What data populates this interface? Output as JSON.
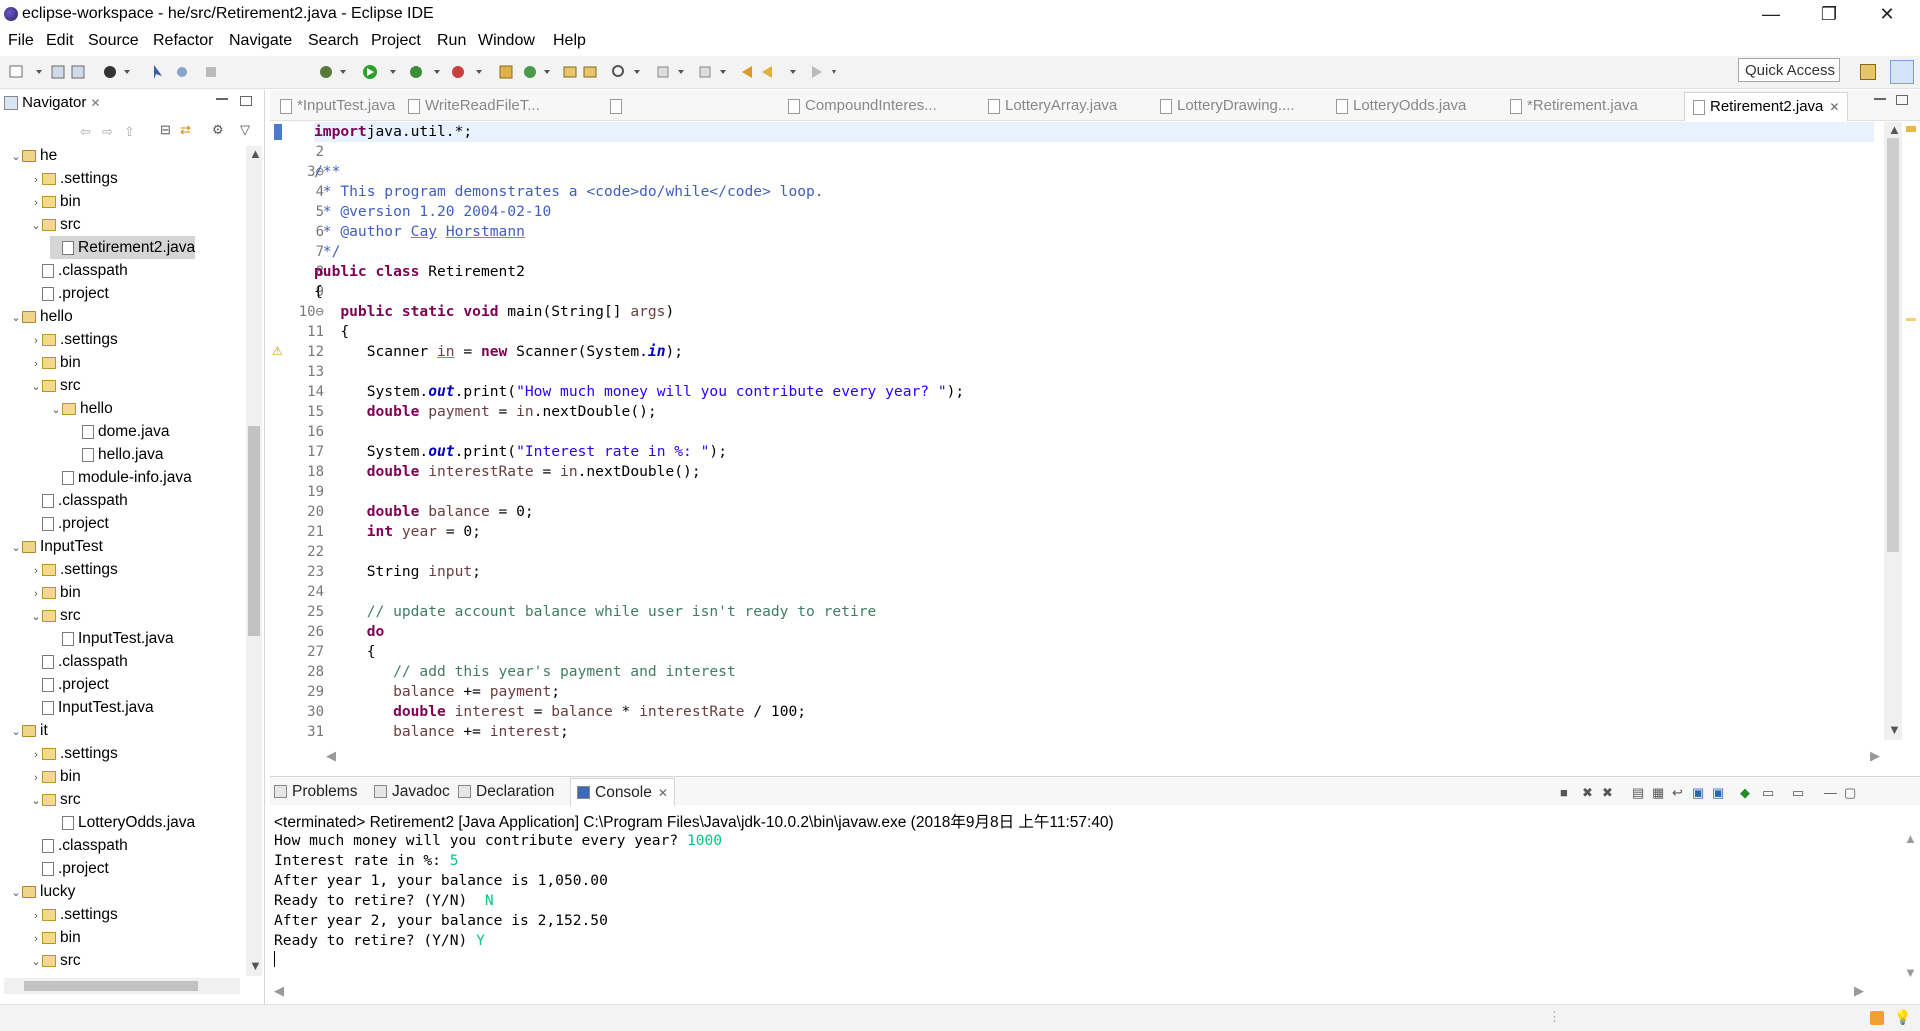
{
  "window": {
    "title": "eclipse-workspace - he/src/Retirement2.java - Eclipse IDE",
    "minimize": "—",
    "maximize": "❐",
    "close": "✕"
  },
  "menu": [
    "File",
    "Edit",
    "Source",
    "Refactor",
    "Navigate",
    "Search",
    "Project",
    "Run",
    "Window",
    "Help"
  ],
  "toolbar": {
    "quick_access": "Quick Access"
  },
  "navigator": {
    "title": "Navigator",
    "close": "✕",
    "tree": [
      {
        "label": "he",
        "depth": 0,
        "type": "project",
        "twist": "v"
      },
      {
        "label": ".settings",
        "depth": 1,
        "type": "folder",
        "twist": ">"
      },
      {
        "label": "bin",
        "depth": 1,
        "type": "folder",
        "twist": ">"
      },
      {
        "label": "src",
        "depth": 1,
        "type": "folder",
        "twist": "v"
      },
      {
        "label": "Retirement2.java",
        "depth": 2,
        "type": "java",
        "twist": "",
        "selected": true
      },
      {
        "label": ".classpath",
        "depth": 1,
        "type": "xml",
        "twist": ""
      },
      {
        "label": ".project",
        "depth": 1,
        "type": "xml",
        "twist": ""
      },
      {
        "label": "hello",
        "depth": 0,
        "type": "project",
        "twist": "v"
      },
      {
        "label": ".settings",
        "depth": 1,
        "type": "folder",
        "twist": ">"
      },
      {
        "label": "bin",
        "depth": 1,
        "type": "folder",
        "twist": ">"
      },
      {
        "label": "src",
        "depth": 1,
        "type": "folder",
        "twist": "v"
      },
      {
        "label": "hello",
        "depth": 2,
        "type": "folder",
        "twist": "v"
      },
      {
        "label": "dome.java",
        "depth": 3,
        "type": "java",
        "twist": ""
      },
      {
        "label": "hello.java",
        "depth": 3,
        "type": "java",
        "twist": ""
      },
      {
        "label": "module-info.java",
        "depth": 2,
        "type": "java",
        "twist": ""
      },
      {
        "label": ".classpath",
        "depth": 1,
        "type": "xml",
        "twist": ""
      },
      {
        "label": ".project",
        "depth": 1,
        "type": "xml",
        "twist": ""
      },
      {
        "label": "InputTest",
        "depth": 0,
        "type": "project",
        "twist": "v"
      },
      {
        "label": ".settings",
        "depth": 1,
        "type": "folder",
        "twist": ">"
      },
      {
        "label": "bin",
        "depth": 1,
        "type": "folder",
        "twist": ">"
      },
      {
        "label": "src",
        "depth": 1,
        "type": "folder",
        "twist": "v"
      },
      {
        "label": "InputTest.java",
        "depth": 2,
        "type": "java",
        "twist": ""
      },
      {
        "label": ".classpath",
        "depth": 1,
        "type": "xml",
        "twist": ""
      },
      {
        "label": ".project",
        "depth": 1,
        "type": "xml",
        "twist": ""
      },
      {
        "label": "InputTest.java",
        "depth": 1,
        "type": "java",
        "twist": ""
      },
      {
        "label": "it",
        "depth": 0,
        "type": "project",
        "twist": "v"
      },
      {
        "label": ".settings",
        "depth": 1,
        "type": "folder",
        "twist": ">"
      },
      {
        "label": "bin",
        "depth": 1,
        "type": "folder",
        "twist": ">"
      },
      {
        "label": "src",
        "depth": 1,
        "type": "folder",
        "twist": "v"
      },
      {
        "label": "LotteryOdds.java",
        "depth": 2,
        "type": "java",
        "twist": ""
      },
      {
        "label": ".classpath",
        "depth": 1,
        "type": "xml",
        "twist": ""
      },
      {
        "label": ".project",
        "depth": 1,
        "type": "xml",
        "twist": ""
      },
      {
        "label": "lucky",
        "depth": 0,
        "type": "project",
        "twist": "v"
      },
      {
        "label": ".settings",
        "depth": 1,
        "type": "folder",
        "twist": ">"
      },
      {
        "label": "bin",
        "depth": 1,
        "type": "folder",
        "twist": ">"
      },
      {
        "label": "src",
        "depth": 1,
        "type": "folder",
        "twist": "v"
      }
    ]
  },
  "editor": {
    "tabs": [
      {
        "label": "*InputTest.java",
        "active": false
      },
      {
        "label": "WriteReadFileT...",
        "active": false
      },
      {
        "label": "",
        "active": false
      },
      {
        "label": "CompoundInteres...",
        "active": false
      },
      {
        "label": "LotteryArray.java",
        "active": false
      },
      {
        "label": "LotteryDrawing....",
        "active": false
      },
      {
        "label": "LotteryOdds.java",
        "active": false
      },
      {
        "label": "*Retirement.java",
        "active": false
      },
      {
        "label": "Retirement2.java",
        "active": true
      }
    ],
    "active_close": "✕",
    "line_numbers": [
      "1",
      "2",
      "3⊖",
      "4",
      "5",
      "6",
      "7",
      "8",
      "9",
      "10⊖",
      "11",
      "12",
      "13",
      "14",
      "15",
      "16",
      "17",
      "18",
      "19",
      "20",
      "21",
      "22",
      "23",
      "24",
      "25",
      "26",
      "27",
      "28",
      "29",
      "30",
      "31"
    ],
    "lines": [
      [
        [
          "kw",
          "import"
        ],
        [
          "",
          "java.util.*;"
        ]
      ],
      [],
      [
        [
          "cm",
          "/**"
        ]
      ],
      [
        [
          "cm",
          " * This program demonstrates a <code>do/while</code> loop."
        ]
      ],
      [
        [
          "cm",
          " * @version 1.20 2004-02-10"
        ]
      ],
      [
        [
          "cm",
          " * @author "
        ],
        [
          "cm ul",
          "Cay"
        ],
        [
          "cm",
          " "
        ],
        [
          "cm ul",
          "Horstmann"
        ]
      ],
      [
        [
          "cm",
          " */"
        ]
      ],
      [
        [
          "kw",
          "public class"
        ],
        [
          "",
          " Retirement2"
        ]
      ],
      [
        [
          "",
          "{"
        ]
      ],
      [
        [
          "",
          "   "
        ],
        [
          "kw",
          "public static void"
        ],
        [
          "",
          " main(String[] "
        ],
        [
          "lv",
          "args"
        ],
        [
          "",
          ")"
        ]
      ],
      [
        [
          "",
          "   {"
        ]
      ],
      [
        [
          "",
          "      Scanner "
        ],
        [
          "lv ul",
          "in"
        ],
        [
          "",
          " = "
        ],
        [
          "kw",
          "new"
        ],
        [
          "",
          " Scanner(System."
        ],
        [
          "fd",
          "in"
        ],
        [
          "",
          ");"
        ]
      ],
      [],
      [
        [
          "",
          "      System."
        ],
        [
          "fd",
          "out"
        ],
        [
          "",
          ".print("
        ],
        [
          "st",
          "\"How much money will you contribute every year? \""
        ],
        [
          "",
          ");"
        ]
      ],
      [
        [
          "",
          "      "
        ],
        [
          "kw",
          "double"
        ],
        [
          "",
          " "
        ],
        [
          "lv",
          "payment"
        ],
        [
          "",
          " = "
        ],
        [
          "lv",
          "in"
        ],
        [
          "",
          ".nextDouble();"
        ]
      ],
      [],
      [
        [
          "",
          "      System."
        ],
        [
          "fd",
          "out"
        ],
        [
          "",
          ".print("
        ],
        [
          "st",
          "\"Interest rate in %: \""
        ],
        [
          "",
          ");"
        ]
      ],
      [
        [
          "",
          "      "
        ],
        [
          "kw",
          "double"
        ],
        [
          "",
          " "
        ],
        [
          "lv",
          "interestRate"
        ],
        [
          "",
          " = "
        ],
        [
          "lv",
          "in"
        ],
        [
          "",
          ".nextDouble();"
        ]
      ],
      [],
      [
        [
          "",
          "      "
        ],
        [
          "kw",
          "double"
        ],
        [
          "",
          " "
        ],
        [
          "lv",
          "balance"
        ],
        [
          "",
          " = 0;"
        ]
      ],
      [
        [
          "",
          "      "
        ],
        [
          "kw",
          "int"
        ],
        [
          "",
          " "
        ],
        [
          "lv",
          "year"
        ],
        [
          "",
          " = 0;"
        ]
      ],
      [],
      [
        [
          "",
          "      String "
        ],
        [
          "lv",
          "input"
        ],
        [
          "",
          ";"
        ]
      ],
      [],
      [
        [
          "",
          "      "
        ],
        [
          "lc",
          "// update account balance while user isn't ready to retire"
        ]
      ],
      [
        [
          "",
          "      "
        ],
        [
          "kw",
          "do"
        ]
      ],
      [
        [
          "",
          "      {"
        ]
      ],
      [
        [
          "",
          "         "
        ],
        [
          "lc",
          "// add this year's payment and interest"
        ]
      ],
      [
        [
          "",
          "         "
        ],
        [
          "lv",
          "balance"
        ],
        [
          "",
          " += "
        ],
        [
          "lv",
          "payment"
        ],
        [
          "",
          ";"
        ]
      ],
      [
        [
          "",
          "         "
        ],
        [
          "kw",
          "double"
        ],
        [
          "",
          " "
        ],
        [
          "lv",
          "interest"
        ],
        [
          "",
          " = "
        ],
        [
          "lv",
          "balance"
        ],
        [
          "",
          " * "
        ],
        [
          "lv",
          "interestRate"
        ],
        [
          "",
          " / 100;"
        ]
      ],
      [
        [
          "",
          "         "
        ],
        [
          "lv",
          "balance"
        ],
        [
          "",
          " += "
        ],
        [
          "lv",
          "interest"
        ],
        [
          "",
          ";"
        ]
      ]
    ]
  },
  "console": {
    "tabs": [
      {
        "label": "Problems",
        "icon": "problems-icon",
        "active": false
      },
      {
        "label": "Javadoc",
        "icon": "javadoc-icon",
        "active": false
      },
      {
        "label": "Declaration",
        "icon": "declaration-icon",
        "active": false
      },
      {
        "label": "Console",
        "icon": "console-icon",
        "active": true
      }
    ],
    "close": "✕",
    "status": "<terminated> Retirement2 [Java Application] C:\\Program Files\\Java\\jdk-10.0.2\\bin\\javaw.exe (2018年9月8日 上午11:57:40)",
    "output": [
      [
        [
          "",
          "How much money will you contribute every year? "
        ],
        [
          "inp",
          "1000"
        ]
      ],
      [
        [
          "",
          "Interest rate in %: "
        ],
        [
          "inp",
          "5"
        ]
      ],
      [
        [
          "",
          "After year 1, your balance is 1,050.00"
        ]
      ],
      [
        [
          "",
          "Ready to retire? (Y/N)  "
        ],
        [
          "inp",
          "N"
        ]
      ],
      [
        [
          "",
          "After year 2, your balance is 2,152.50"
        ]
      ],
      [
        [
          "",
          "Ready to retire? (Y/N) "
        ],
        [
          "inp",
          "Y"
        ]
      ]
    ]
  },
  "colors": {
    "keyword": "#7f0055",
    "javadoc": "#3f5fbf",
    "line_comment": "#3f7f5f",
    "string": "#2a00ff",
    "static_field": "#0000c0",
    "local_var": "#6a3e3e",
    "console_input": "#00c87d"
  }
}
